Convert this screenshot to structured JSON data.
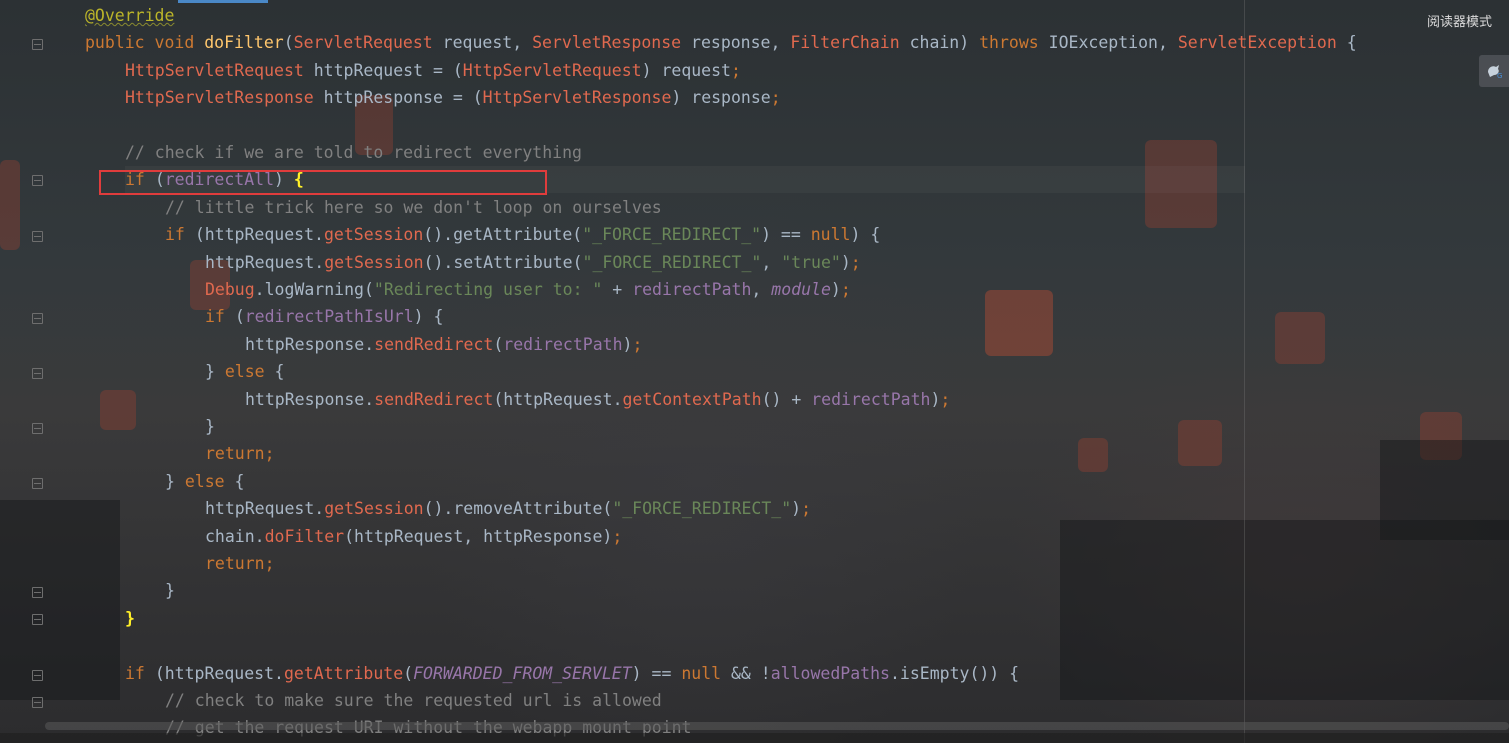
{
  "editor": {
    "reader_mode_label": "阅读器模式",
    "icons": {
      "plugin": "translate-plugin-icon",
      "fold": "fold-marker-icon"
    },
    "colors": {
      "keyword": "#cc7832",
      "type": "#e0694f",
      "method_decl": "#ffc66d",
      "field": "#9876aa",
      "string": "#6a8759",
      "comment": "#808080",
      "annotation": "#bbb529",
      "plain": "#a9b7c6",
      "highlight_box": "#e03c3c"
    },
    "code_lines": [
      {
        "indent": 0,
        "tokens": [
          [
            "ann",
            "@Override"
          ]
        ]
      },
      {
        "indent": 0,
        "tokens": [
          [
            "kw",
            "public "
          ],
          [
            "kw",
            "void "
          ],
          [
            "fn",
            "doFilter"
          ],
          [
            "id",
            "("
          ],
          [
            "type",
            "ServletRequest"
          ],
          [
            "id",
            " request, "
          ],
          [
            "type",
            "ServletResponse"
          ],
          [
            "id",
            " response, "
          ],
          [
            "type",
            "FilterChain"
          ],
          [
            "id",
            " chain) "
          ],
          [
            "kw",
            "throws "
          ],
          [
            "id",
            "IOException, "
          ],
          [
            "type",
            "ServletException"
          ],
          [
            "id",
            " {"
          ]
        ]
      },
      {
        "indent": 1,
        "tokens": [
          [
            "type",
            "HttpServletRequest"
          ],
          [
            "id",
            " httpRequest = ("
          ],
          [
            "type",
            "HttpServletRequest"
          ],
          [
            "id",
            ") request"
          ],
          [
            "kwb",
            ";"
          ]
        ]
      },
      {
        "indent": 1,
        "tokens": [
          [
            "type",
            "HttpServletResponse"
          ],
          [
            "id",
            " httpResponse = ("
          ],
          [
            "type",
            "HttpServletResponse"
          ],
          [
            "id",
            ") response"
          ],
          [
            "kwb",
            ";"
          ]
        ]
      },
      {
        "indent": 0,
        "tokens": []
      },
      {
        "indent": 1,
        "tokens": [
          [
            "cmt",
            "// check if we are told to redirect everything"
          ]
        ]
      },
      {
        "indent": 1,
        "tokens": [
          [
            "kw",
            "if "
          ],
          [
            "id",
            "("
          ],
          [
            "field",
            "redirectAll"
          ],
          [
            "id",
            ") "
          ],
          [
            "brace-hl",
            "{"
          ]
        ]
      },
      {
        "indent": 2,
        "tokens": [
          [
            "cmt",
            "// little trick here so we don't loop on ourselves"
          ]
        ]
      },
      {
        "indent": 2,
        "tokens": [
          [
            "kw",
            "if "
          ],
          [
            "id",
            "(httpRequest."
          ],
          [
            "call",
            "getSession"
          ],
          [
            "id",
            "().getAttribute("
          ],
          [
            "str",
            "\"_FORCE_REDIRECT_\""
          ],
          [
            "id",
            ") == "
          ],
          [
            "kw",
            "null"
          ],
          [
            "id",
            ") {"
          ]
        ]
      },
      {
        "indent": 3,
        "tokens": [
          [
            "id",
            "httpRequest."
          ],
          [
            "call",
            "getSession"
          ],
          [
            "id",
            "().setAttribute("
          ],
          [
            "str",
            "\"_FORCE_REDIRECT_\""
          ],
          [
            "id",
            ", "
          ],
          [
            "str",
            "\"true\""
          ],
          [
            "id",
            ")"
          ],
          [
            "kwb",
            ";"
          ]
        ]
      },
      {
        "indent": 3,
        "tokens": [
          [
            "type",
            "Debug"
          ],
          [
            "id",
            ".logWarning("
          ],
          [
            "str",
            "\"Redirecting user to: \""
          ],
          [
            "id",
            " + "
          ],
          [
            "field",
            "redirectPath"
          ],
          [
            "id",
            ", "
          ],
          [
            "field ital",
            "module"
          ],
          [
            "id",
            ")"
          ],
          [
            "kwb",
            ";"
          ]
        ]
      },
      {
        "indent": 3,
        "tokens": [
          [
            "kw",
            "if "
          ],
          [
            "id",
            "("
          ],
          [
            "field",
            "redirectPathIsUrl"
          ],
          [
            "id",
            ") {"
          ]
        ]
      },
      {
        "indent": 4,
        "tokens": [
          [
            "id",
            "httpResponse."
          ],
          [
            "call",
            "sendRedirect"
          ],
          [
            "id",
            "("
          ],
          [
            "field",
            "redirectPath"
          ],
          [
            "id",
            ")"
          ],
          [
            "kwb",
            ";"
          ]
        ]
      },
      {
        "indent": 3,
        "tokens": [
          [
            "id",
            "} "
          ],
          [
            "kw",
            "else "
          ],
          [
            "id",
            "{"
          ]
        ]
      },
      {
        "indent": 4,
        "tokens": [
          [
            "id",
            "httpResponse."
          ],
          [
            "call",
            "sendRedirect"
          ],
          [
            "id",
            "(httpRequest."
          ],
          [
            "call",
            "getContextPath"
          ],
          [
            "id",
            "() + "
          ],
          [
            "field",
            "redirectPath"
          ],
          [
            "id",
            ")"
          ],
          [
            "kwb",
            ";"
          ]
        ]
      },
      {
        "indent": 3,
        "tokens": [
          [
            "id",
            "}"
          ]
        ]
      },
      {
        "indent": 3,
        "tokens": [
          [
            "kw",
            "return"
          ],
          [
            "kwb",
            ";"
          ]
        ]
      },
      {
        "indent": 2,
        "tokens": [
          [
            "id",
            "} "
          ],
          [
            "kw",
            "else "
          ],
          [
            "id",
            "{"
          ]
        ]
      },
      {
        "indent": 3,
        "tokens": [
          [
            "id",
            "httpRequest."
          ],
          [
            "call",
            "getSession"
          ],
          [
            "id",
            "().removeAttribute("
          ],
          [
            "str",
            "\"_FORCE_REDIRECT_\""
          ],
          [
            "id",
            ")"
          ],
          [
            "kwb",
            ";"
          ]
        ]
      },
      {
        "indent": 3,
        "tokens": [
          [
            "id",
            "chain."
          ],
          [
            "call",
            "doFilter"
          ],
          [
            "id",
            "(httpRequest, httpResponse)"
          ],
          [
            "kwb",
            ";"
          ]
        ]
      },
      {
        "indent": 3,
        "tokens": [
          [
            "kw",
            "return"
          ],
          [
            "kwb",
            ";"
          ]
        ]
      },
      {
        "indent": 2,
        "tokens": [
          [
            "id",
            "}"
          ]
        ]
      },
      {
        "indent": 1,
        "tokens": [
          [
            "brace-hl",
            "}"
          ]
        ]
      },
      {
        "indent": 0,
        "tokens": []
      },
      {
        "indent": 1,
        "tokens": [
          [
            "kw",
            "if "
          ],
          [
            "id",
            "(httpRequest."
          ],
          [
            "call",
            "getAttribute"
          ],
          [
            "id",
            "("
          ],
          [
            "field ital",
            "FORWARDED_FROM_SERVLET"
          ],
          [
            "id",
            ") == "
          ],
          [
            "kw",
            "null "
          ],
          [
            "id",
            "&& !"
          ],
          [
            "field",
            "allowedPaths"
          ],
          [
            "id",
            ".isEmpty()) {"
          ]
        ]
      },
      {
        "indent": 2,
        "tokens": [
          [
            "cmt",
            "// check to make sure the requested url is allowed"
          ]
        ]
      },
      {
        "indent": 2,
        "tokens": [
          [
            "cmt",
            "// get the request URI without the webapp mount point"
          ]
        ]
      }
    ]
  }
}
